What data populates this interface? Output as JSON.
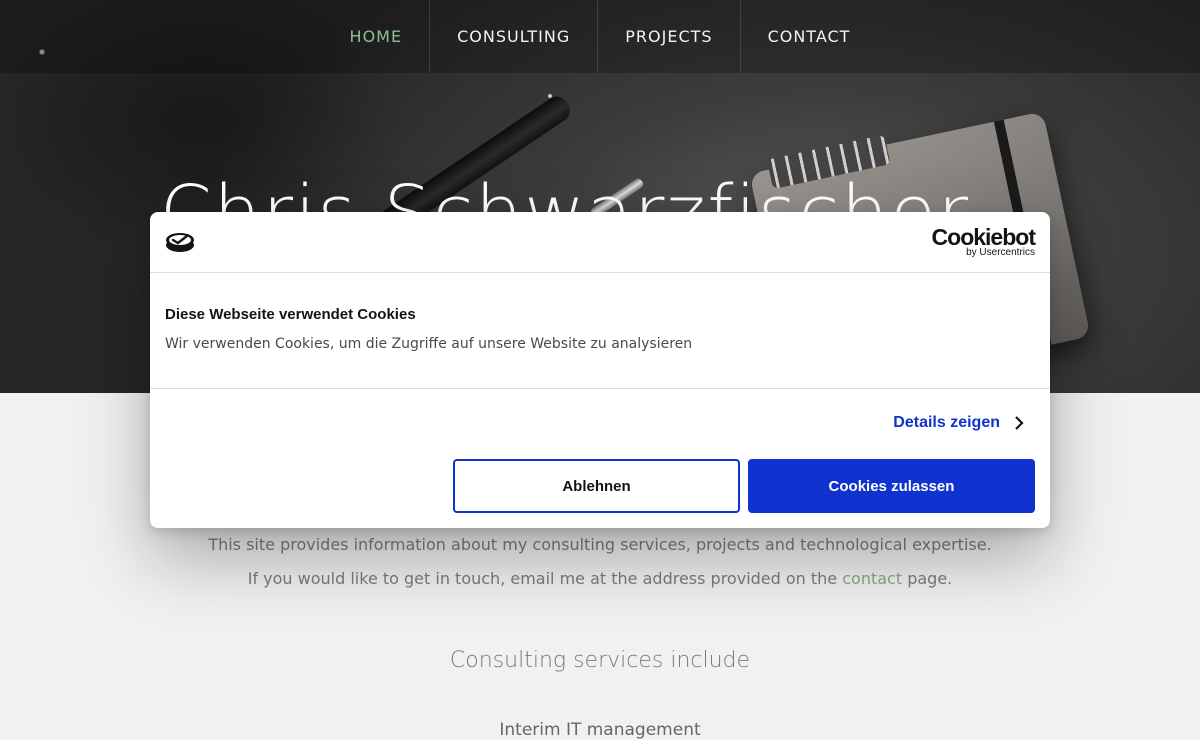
{
  "nav": {
    "items": [
      {
        "label": "HOME",
        "active": true
      },
      {
        "label": "CONSULTING",
        "active": false
      },
      {
        "label": "PROJECTS",
        "active": false
      },
      {
        "label": "CONTACT",
        "active": false
      }
    ]
  },
  "hero": {
    "title": "Chris Schwarzfischer"
  },
  "content": {
    "intro_line1": "This site provides information about my consulting services, projects and technological expertise.",
    "intro_line2_before": "If you would like to get in touch, email me at the address provided on the ",
    "intro_line2_link": "contact",
    "intro_line2_after": " page.",
    "services_title": "Consulting services include",
    "first_service": "Interim IT management"
  },
  "cookie_dialog": {
    "brand_name": "Cookiebot",
    "brand_sub": "by Usercentrics",
    "title": "Diese Webseite verwendet Cookies",
    "text": "Wir verwenden Cookies, um die Zugriffe auf unsere Website zu analysieren",
    "details_label": "Details zeigen",
    "decline_label": "Ablehnen",
    "accept_label": "Cookies zulassen"
  },
  "colors": {
    "accent_green": "#8fbf95",
    "cookiebot_blue": "#1032cf"
  }
}
